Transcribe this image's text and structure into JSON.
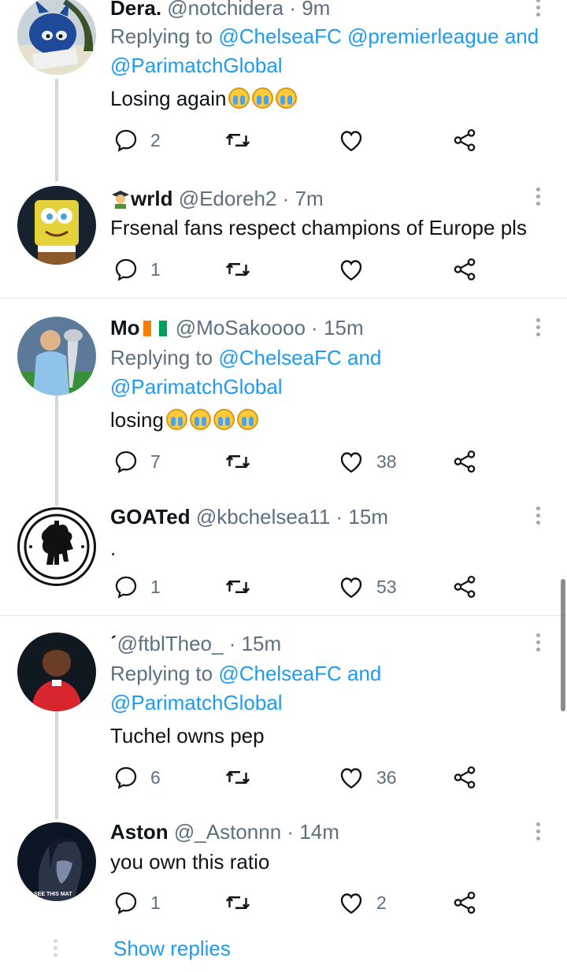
{
  "tweets": [
    {
      "display_name": "Dera.",
      "handle": "@notchidera",
      "time": "· 9m",
      "reply_prefix": "Replying to",
      "reply_line1_mentions": "@ChelseaFC @premierleague",
      "reply_and": "and",
      "reply_line2_mention": "@ParimatchGlobal",
      "text": "Losing again",
      "emoji": "loudly-crying-face x3",
      "replies": "2",
      "retweets": "",
      "likes": ""
    },
    {
      "display_name": "wrld",
      "name_emoji": "student-emoji",
      "handle": "@Edoreh2",
      "time": "· 7m",
      "text": "Frsenal fans respect champions of Europe pls",
      "replies": "1",
      "retweets": "",
      "likes": ""
    },
    {
      "display_name": "Mo",
      "name_emoji": "ivory-coast-flag",
      "handle": "@MoSakoooo",
      "time": "· 15m",
      "reply_prefix": "Replying to",
      "reply_line1_mentions": "@ChelseaFC",
      "reply_and": "and",
      "reply_line2_mention": "@ParimatchGlobal",
      "text": "losing",
      "emoji": "loudly-crying-face x4",
      "replies": "7",
      "retweets": "",
      "likes": "38"
    },
    {
      "display_name": "GOATed",
      "handle": "@kbchelsea11",
      "time": "· 15m",
      "text": ".",
      "replies": "1",
      "retweets": "",
      "likes": "53"
    },
    {
      "display_name": "ˊ",
      "handle": "@ftblTheo_",
      "time": "· 15m",
      "reply_prefix": "Replying to",
      "reply_line1_mentions": "@ChelseaFC",
      "reply_and": "and",
      "reply_line2_mention": "@ParimatchGlobal",
      "text": "Tuchel owns pep",
      "replies": "6",
      "retweets": "",
      "likes": "36"
    },
    {
      "display_name": "Aston",
      "handle": "@_Astonnn",
      "time": "· 14m",
      "text": "you own this ratio",
      "avatar_caption": "U SEE THIS MAT",
      "replies": "1",
      "retweets": "",
      "likes": "2"
    }
  ],
  "show_replies": "Show replies",
  "colors": {
    "link": "#1d9bf0",
    "muted": "#5b7083",
    "text": "#0f1419",
    "thread_line": "#cfd9de"
  },
  "icons": [
    "reply-icon",
    "retweet-icon",
    "like-icon",
    "share-icon",
    "more-options-icon"
  ]
}
